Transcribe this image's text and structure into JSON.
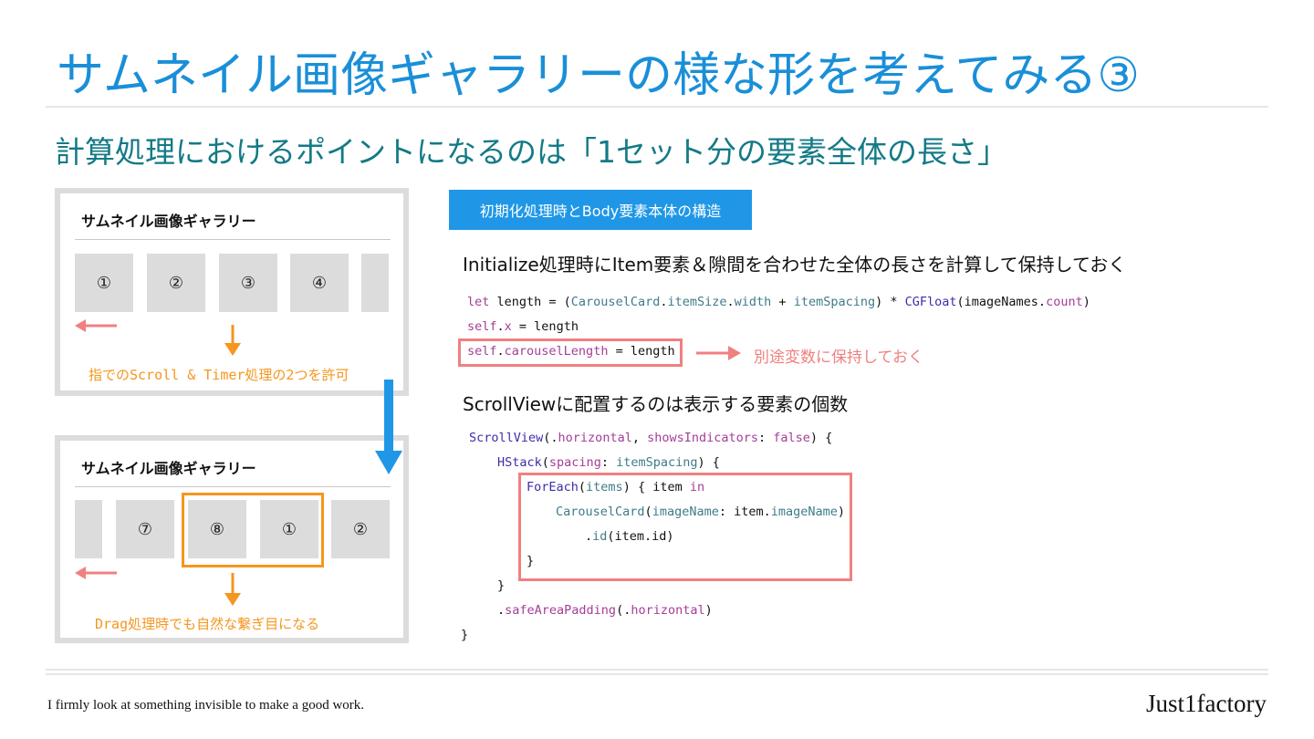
{
  "slide": {
    "title": "サムネイル画像ギャラリーの様な形を考えてみる③",
    "subtitle": "計算処理におけるポイントになるのは「1セット分の要素全体の長さ」"
  },
  "panel_top": {
    "title": "サムネイル画像ギャラリー",
    "thumbs": [
      "①",
      "②",
      "③",
      "④"
    ],
    "caption": "指でのScroll & Timer処理の2つを許可"
  },
  "panel_bottom": {
    "title": "サムネイル画像ギャラリー",
    "thumbs": [
      "⑦",
      "⑧",
      "①",
      "②"
    ],
    "caption": "Drag処理時でも自然な繋ぎ目になる"
  },
  "right": {
    "tag": "初期化処理時とBody要素本体の構造",
    "note1": "Initialize処理時にItem要素＆隙間を合わせた全体の長さを計算して保持しておく",
    "code1": {
      "l1_let": "let",
      "l1_a": " length = (",
      "l1_type": "CarouselCard",
      "l1_dot1": ".",
      "l1_prop1": "itemSize",
      "l1_dot2": ".",
      "l1_prop2": "width",
      "l1_plus": " + ",
      "l1_prop3": "itemSpacing",
      "l1_mul": ") * ",
      "l1_type2": "CGFloat",
      "l1_arg": "(imageNames.",
      "l1_prop4": "count",
      "l1_end": ")",
      "l2_self": "self",
      "l2_dot": ".",
      "l2_prop": "x",
      "l2_rest": " = length",
      "l3_self": "self",
      "l3_dot": ".",
      "l3_prop": "carouselLength",
      "l3_rest": " = length"
    },
    "arrow_note": "別途変数に保持しておく",
    "note2": "ScrollViewに配置するのは表示する要素の個数",
    "code2": {
      "l1_type": "ScrollView",
      "l1_a": "(.",
      "l1_prop": "horizontal",
      "l1_b": ", ",
      "l1_param": "showsIndicators",
      "l1_c": ": ",
      "l1_kw": "false",
      "l1_d": ") {",
      "l2_type": "HStack",
      "l2_a": "(",
      "l2_param": "spacing",
      "l2_b": ": ",
      "l2_prop": "itemSpacing",
      "l2_c": ") {",
      "l3_type": "ForEach",
      "l3_a": "(",
      "l3_prop": "items",
      "l3_b": ") { item ",
      "l3_kw": "in",
      "l4_type": "CarouselCard",
      "l4_a": "(",
      "l4_param": "imageName",
      "l4_b": ": item.",
      "l4_prop": "imageName",
      "l4_c": ")",
      "l5_a": ".",
      "l5_prop": "id",
      "l5_b": "(item.id)",
      "l6": "}",
      "l7": "}",
      "l8_a": ".",
      "l8_kw": "safeAreaPadding",
      "l8_b": "(.",
      "l8_prop": "horizontal",
      "l8_c": ")",
      "l9": "}"
    }
  },
  "footer": {
    "tagline": "I firmly look at something invisible to make a good work.",
    "brand": "Just1factory"
  },
  "colors": {
    "title": "#1a8fd8",
    "subtitle": "#137a86",
    "accent_orange": "#f5961e",
    "accent_red": "#f08080",
    "arrow_blue": "#1f97e6",
    "tag_bg": "#1f97e6"
  }
}
